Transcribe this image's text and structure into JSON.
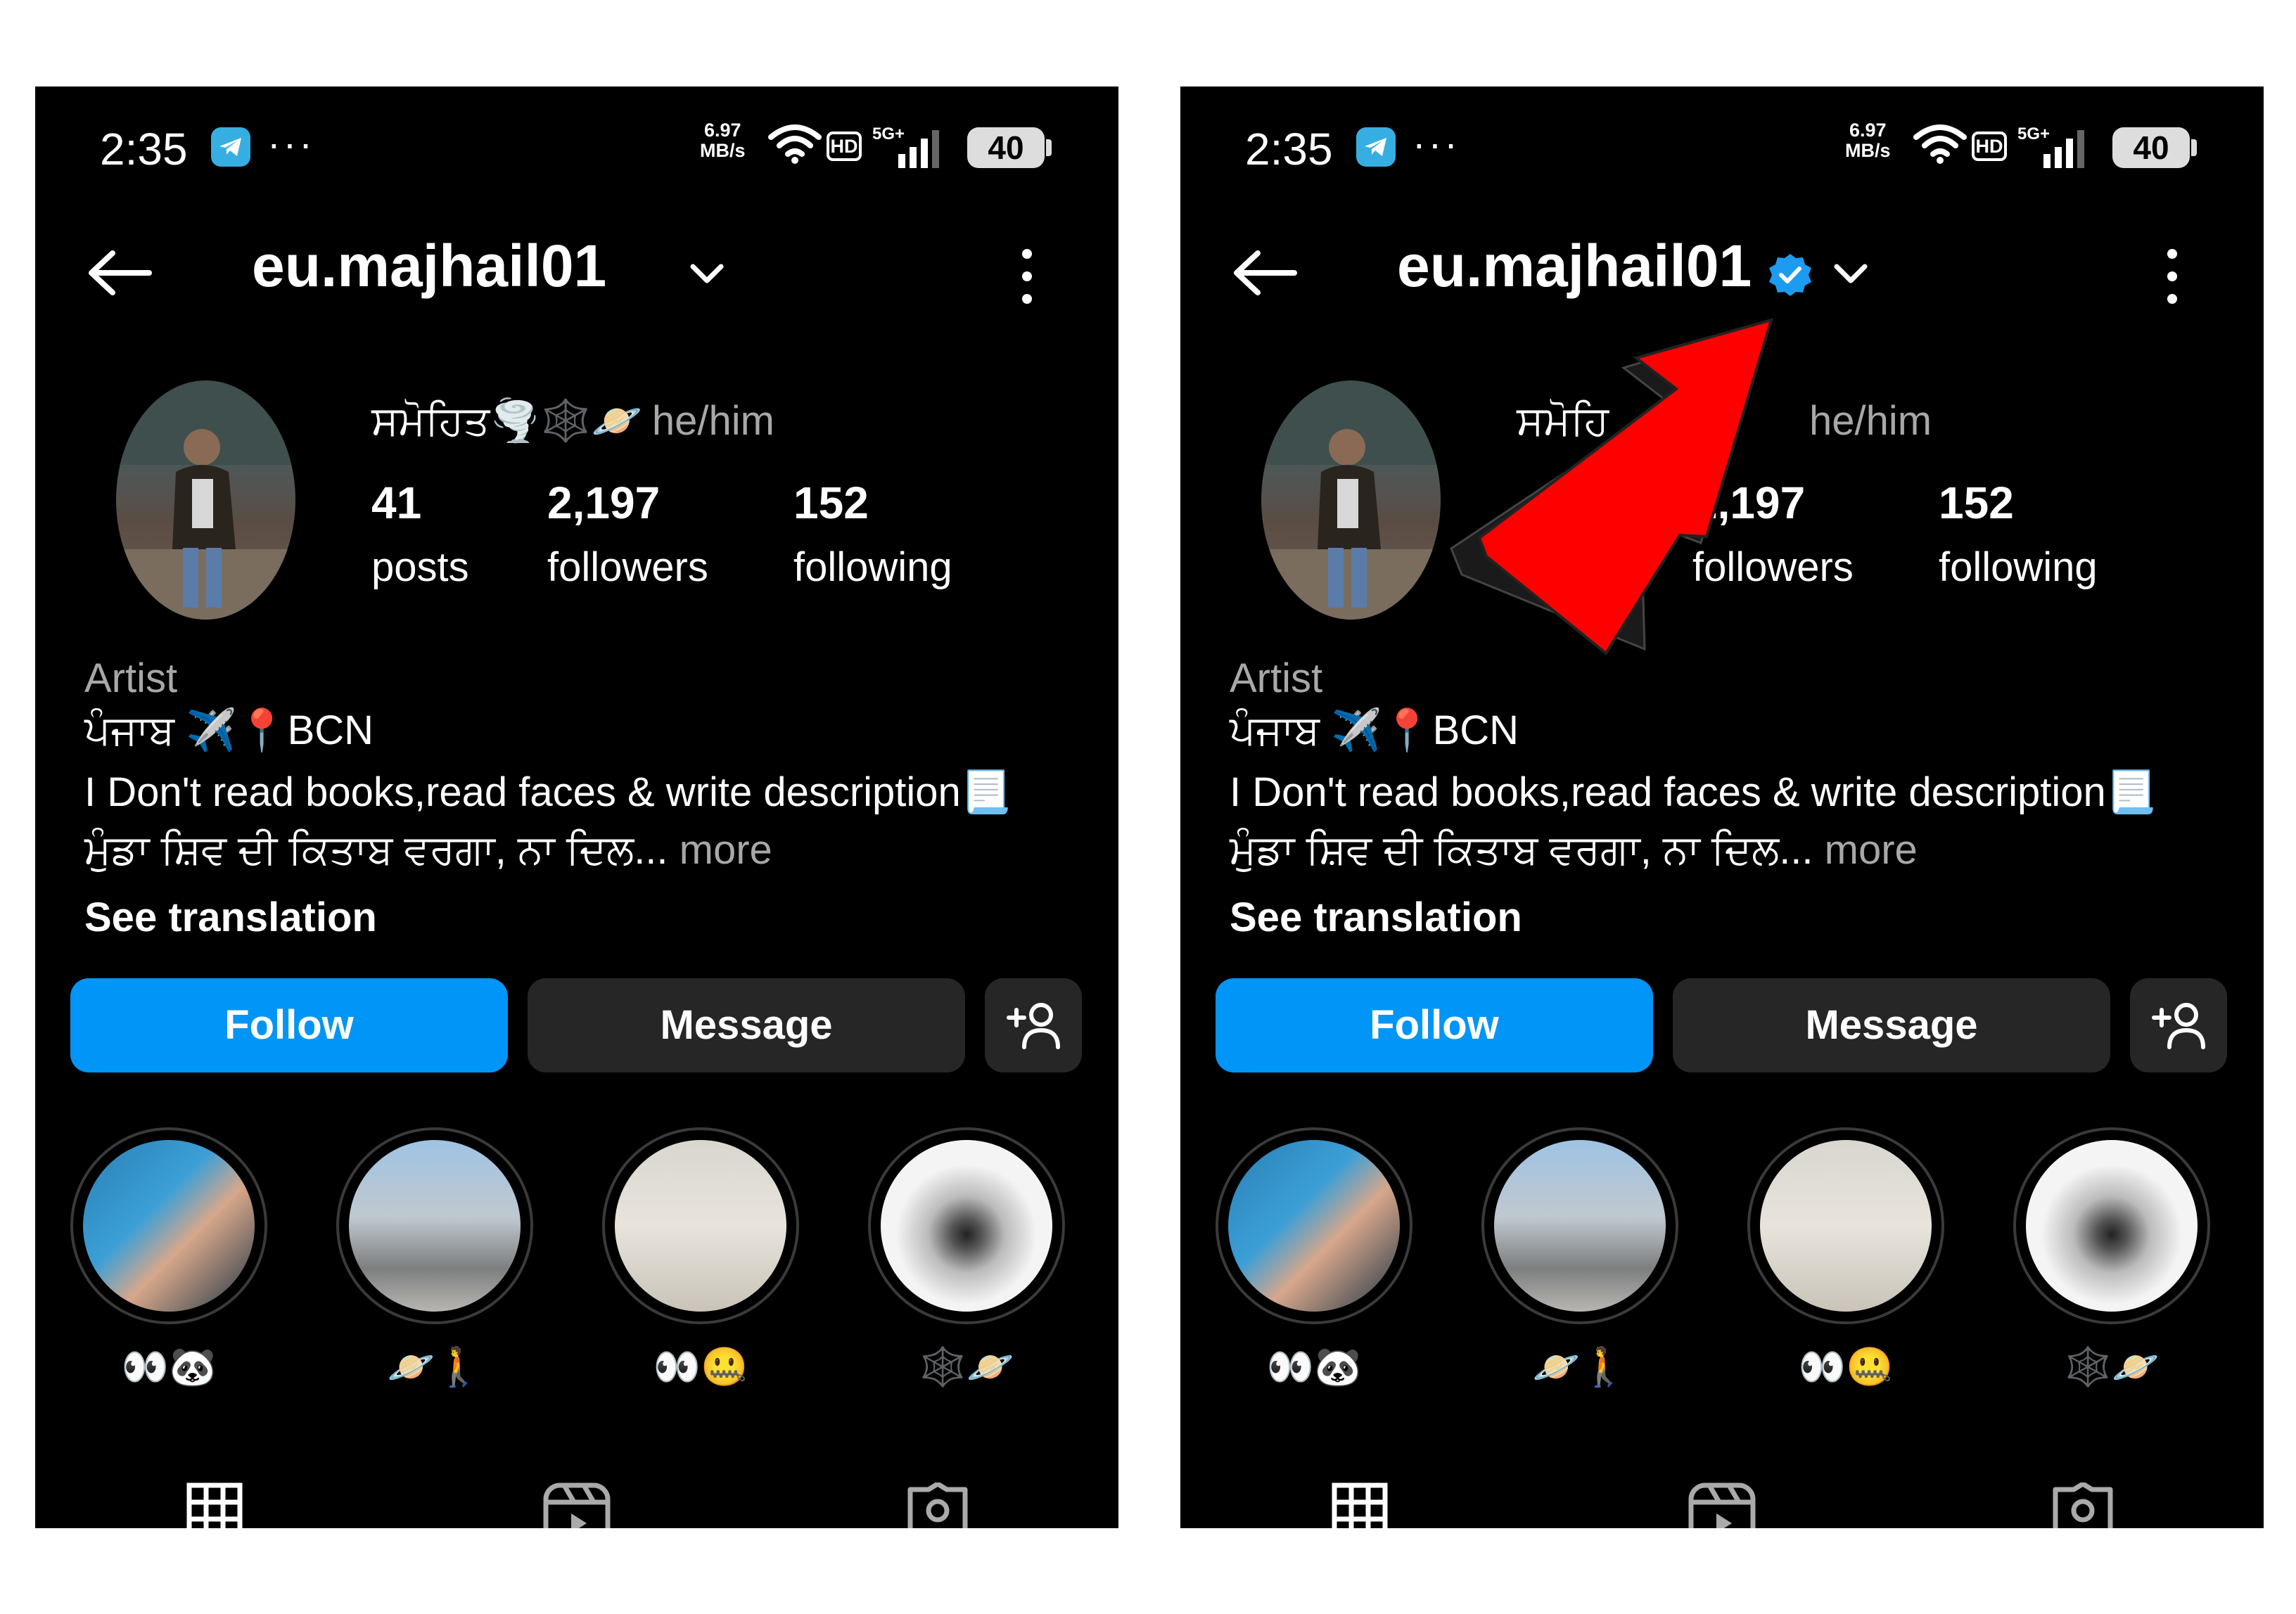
{
  "screens": [
    {
      "status": {
        "time": "2:35",
        "speed_value": "6.97",
        "speed_unit": "MB/s",
        "network": "5G+",
        "battery": "40",
        "more_dots": "···"
      },
      "header": {
        "username": "eu.majhail01",
        "verified": false
      },
      "profile": {
        "display_name": "ਸਮੋਹਿਤ🌪️🕸️🪐",
        "pronouns": "he/him",
        "stats": [
          {
            "value": "41",
            "label": "posts"
          },
          {
            "value": "2,197",
            "label": "followers"
          },
          {
            "value": "152",
            "label": "following"
          }
        ],
        "category": "Artist",
        "bio_line1": "ਪੰਜਾਬ ✈️📍BCN",
        "bio_line2": "I Don't read books,read faces & write description📃",
        "bio_line3": "ਮੁੰਡਾ ਸ਼ਿਵ ਦੀ ਕਿਤਾਬ ਵਰਗਾ, ਨਾ ਦਿਲ...",
        "more": "more",
        "see_translation": "See translation"
      },
      "actions": {
        "follow": "Follow",
        "message": "Message"
      },
      "highlights": [
        {
          "label": "👀🐼"
        },
        {
          "label": "🪐🚶"
        },
        {
          "label": "👀🤐"
        },
        {
          "label": "🕸️🪐"
        }
      ]
    },
    {
      "status": {
        "time": "2:35",
        "speed_value": "6.97",
        "speed_unit": "MB/s",
        "network": "5G+",
        "battery": "40",
        "more_dots": "···"
      },
      "header": {
        "username": "eu.majhail01",
        "verified": true,
        "verified_color": "#1d9bf0"
      },
      "profile": {
        "display_name_visible": "ਸਮੋਹਿ",
        "pronouns": "he/him",
        "stats": [
          {
            "value": "2,197",
            "label": "followers"
          },
          {
            "value": "152",
            "label": "following"
          }
        ],
        "category": "Artist",
        "bio_line1": "ਪੰਜਾਬ ✈️📍BCN",
        "bio_line2": "I Don't read books,read faces & write description📃",
        "bio_line3": "ਮੁੰਡਾ ਸ਼ਿਵ ਦੀ ਕਿਤਾਬ ਵਰਗਾ, ਨਾ ਦਿਲ...",
        "more": "more",
        "see_translation": "See translation"
      },
      "actions": {
        "follow": "Follow",
        "message": "Message"
      },
      "highlights": [
        {
          "label": "👀🐼"
        },
        {
          "label": "🪐🚶"
        },
        {
          "label": "👀🤐"
        },
        {
          "label": "🕸️🪐"
        }
      ],
      "annotation": {
        "arrow_color": "#ff0000",
        "points_to": "verified-badge"
      }
    }
  ],
  "colors": {
    "follow_button": "#0095f6",
    "secondary_button": "#262626",
    "muted_text": "#a8a8a8",
    "telegram": "#37aee2"
  }
}
